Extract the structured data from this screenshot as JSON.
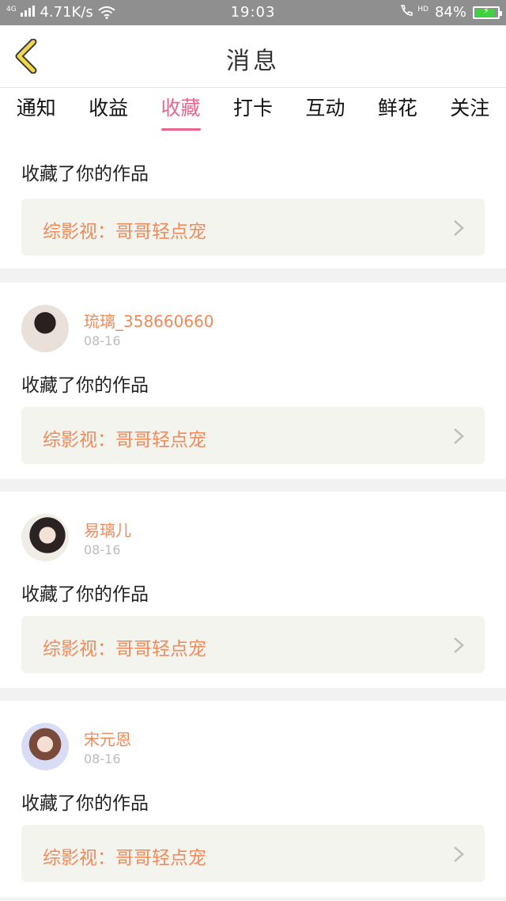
{
  "status_bar": {
    "network": "4G",
    "speed": "4.71K/s",
    "time": "19:03",
    "hd": "HD",
    "battery": "84%"
  },
  "header": {
    "title": "消息"
  },
  "tabs": [
    {
      "label": "通知",
      "active": false
    },
    {
      "label": "收益",
      "active": false
    },
    {
      "label": "收藏",
      "active": true
    },
    {
      "label": "打卡",
      "active": false
    },
    {
      "label": "互动",
      "active": false
    },
    {
      "label": "鲜花",
      "active": false
    },
    {
      "label": "关注",
      "active": false
    }
  ],
  "notifications": [
    {
      "username": "",
      "date": "",
      "action": "收藏了你的作品",
      "work": "综影视：哥哥轻点宠"
    },
    {
      "username": "琉璃_358660660",
      "date": "08-16",
      "action": "收藏了你的作品",
      "work": "综影视：哥哥轻点宠"
    },
    {
      "username": "易璃儿",
      "date": "08-16",
      "action": "收藏了你的作品",
      "work": "综影视：哥哥轻点宠"
    },
    {
      "username": "宋元恩",
      "date": "08-16",
      "action": "收藏了你的作品",
      "work": "综影视：哥哥轻点宠"
    }
  ],
  "colors": {
    "accent": "#e8668e",
    "username": "#ef8a5a",
    "back_icon": "#f0d64a"
  }
}
